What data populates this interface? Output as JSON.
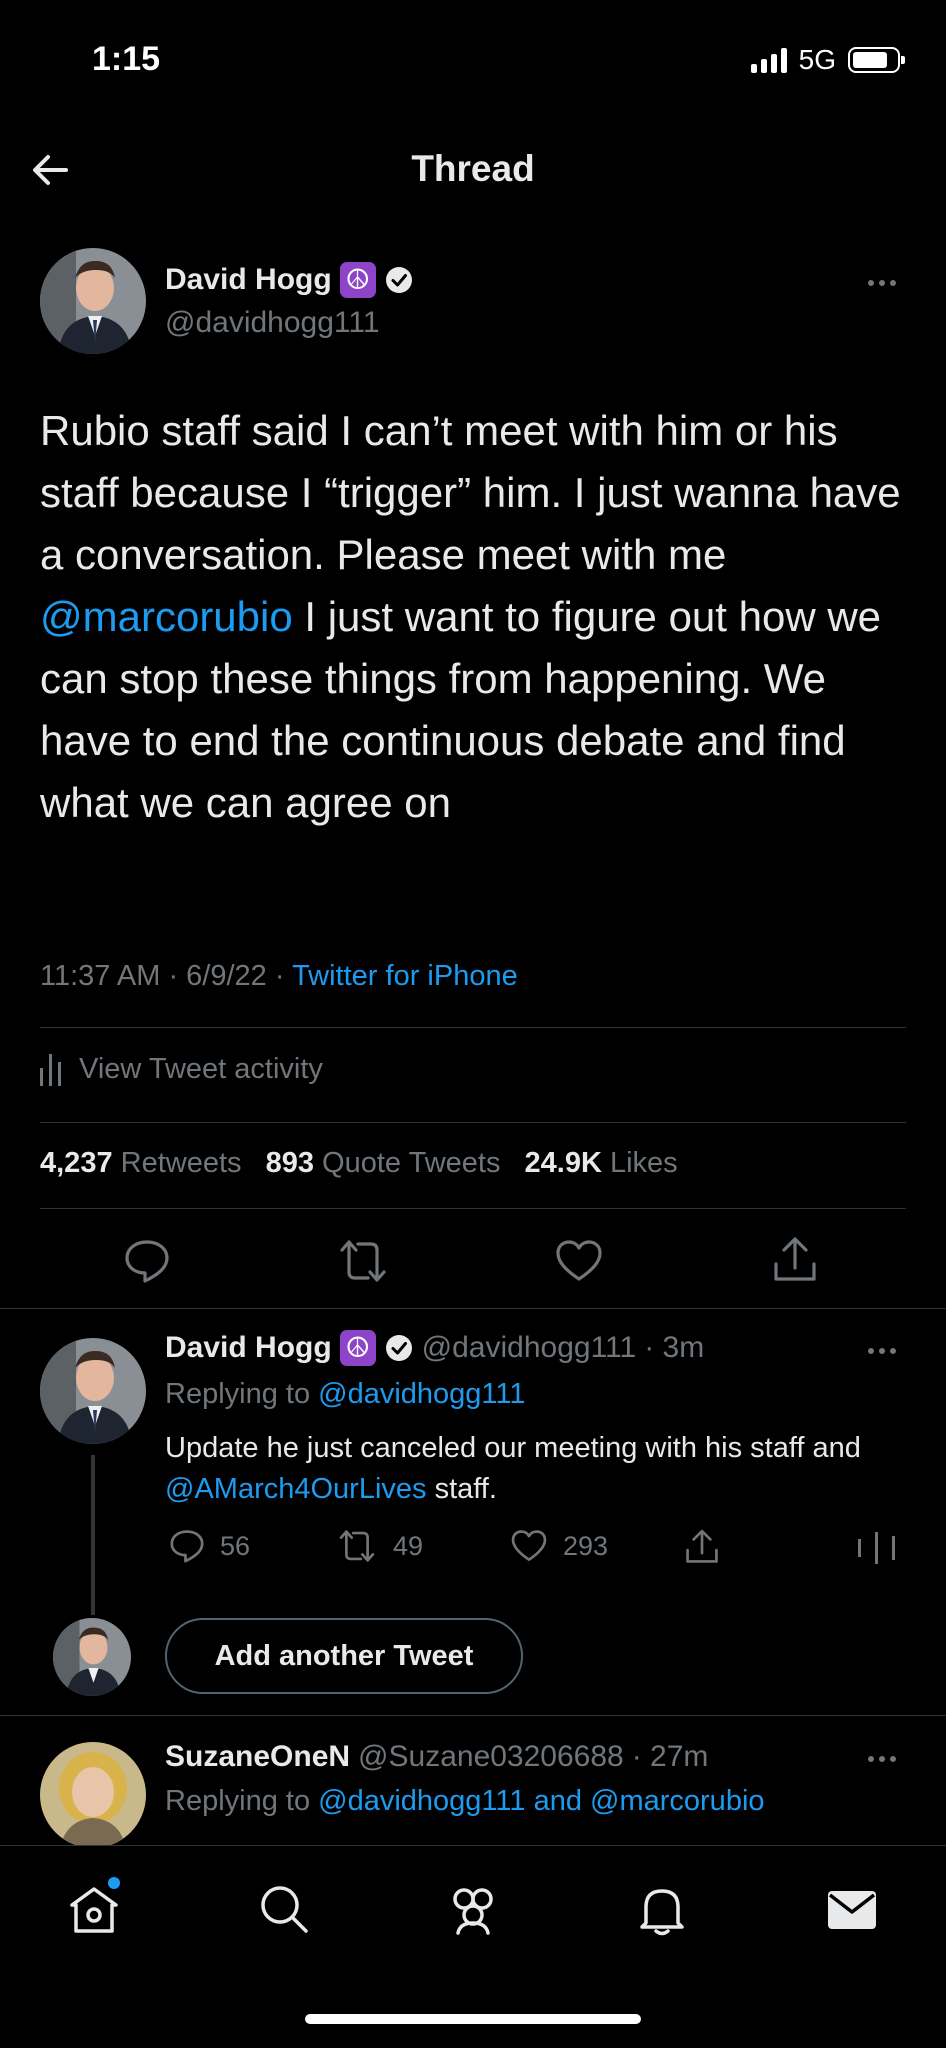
{
  "status_bar": {
    "time": "1:15",
    "network": "5G"
  },
  "header": {
    "title": "Thread"
  },
  "main_tweet": {
    "display_name": "David Hogg",
    "handle": "@davidhogg111",
    "badge": "☮",
    "text_parts": [
      "Rubio staff said I can’t meet with him or his staff because I “trigger” him. I just wanna have a conversation. Please meet with me ",
      "@marcorubio",
      " I just want to figure out how we can stop these things from happening. We have to end the continuous debate and find what we can agree on"
    ],
    "time": "11:37 AM",
    "date": "6/9/22",
    "source": "Twitter for iPhone",
    "activity_label": "View Tweet activity",
    "retweets_count": "4,237",
    "retweets_label": "Retweets",
    "quotes_count": "893",
    "quotes_label": "Quote Tweets",
    "likes_count": "24.9K",
    "likes_label": "Likes"
  },
  "reply_tweet": {
    "display_name": "David Hogg",
    "handle": "@davidhogg111",
    "time": "· 3m",
    "replying_prefix": "Replying to ",
    "replying_to": "@davidhogg111",
    "text_a": "Update he just canceled our meeting with his staff and ",
    "text_mention": "@AMarch4OurLives",
    "text_b": " staff.",
    "replies": "56",
    "retweets": "49",
    "likes": "293"
  },
  "add_tweet_label": "Add another Tweet",
  "third_tweet": {
    "display_name": "SuzaneOneN",
    "handle": "@Suzane03206688",
    "time": "· 27m",
    "replying_prefix": "Replying to ",
    "replying_to": "@davidhogg111 and @marcorubio"
  },
  "colors": {
    "accent": "#1d9bf0",
    "background": "#000000",
    "muted": "#71767b",
    "badge": "#8e44c9"
  },
  "nav_icons": [
    "home-icon",
    "search-icon",
    "communities-icon",
    "notifications-icon",
    "messages-icon"
  ]
}
